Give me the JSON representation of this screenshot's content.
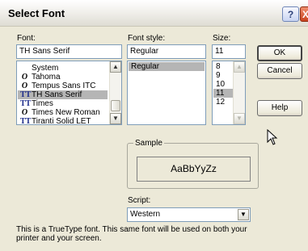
{
  "window": {
    "title": "Select Font",
    "help_button": "?",
    "close_button": "X"
  },
  "font": {
    "label": "Font:",
    "value": "TH Sans Serif",
    "items": [
      {
        "name": "System",
        "icon": "",
        "selected": false
      },
      {
        "name": "Tahoma",
        "icon": "O",
        "selected": false
      },
      {
        "name": "Tempus Sans ITC",
        "icon": "O",
        "selected": false
      },
      {
        "name": "TH Sans Serif",
        "icon": "TT",
        "selected": true
      },
      {
        "name": "Times",
        "icon": "TT",
        "selected": false
      },
      {
        "name": "Times New Roman",
        "icon": "O",
        "selected": false
      },
      {
        "name": "Tiranti Solid LET",
        "icon": "TT",
        "selected": false
      }
    ]
  },
  "font_style": {
    "label": "Font style:",
    "value": "Regular",
    "items": [
      "Regular"
    ]
  },
  "size": {
    "label": "Size:",
    "value": "11",
    "items": [
      "8",
      "9",
      "10",
      "11",
      "12"
    ],
    "selected": "11"
  },
  "buttons": {
    "ok": "OK",
    "cancel": "Cancel",
    "help": "Help"
  },
  "sample": {
    "label": "Sample",
    "text": "AaBbYyZz"
  },
  "script": {
    "label": "Script:",
    "value": "Western"
  },
  "description": "This is a TrueType font. This same font will be used on both your printer and your screen."
}
